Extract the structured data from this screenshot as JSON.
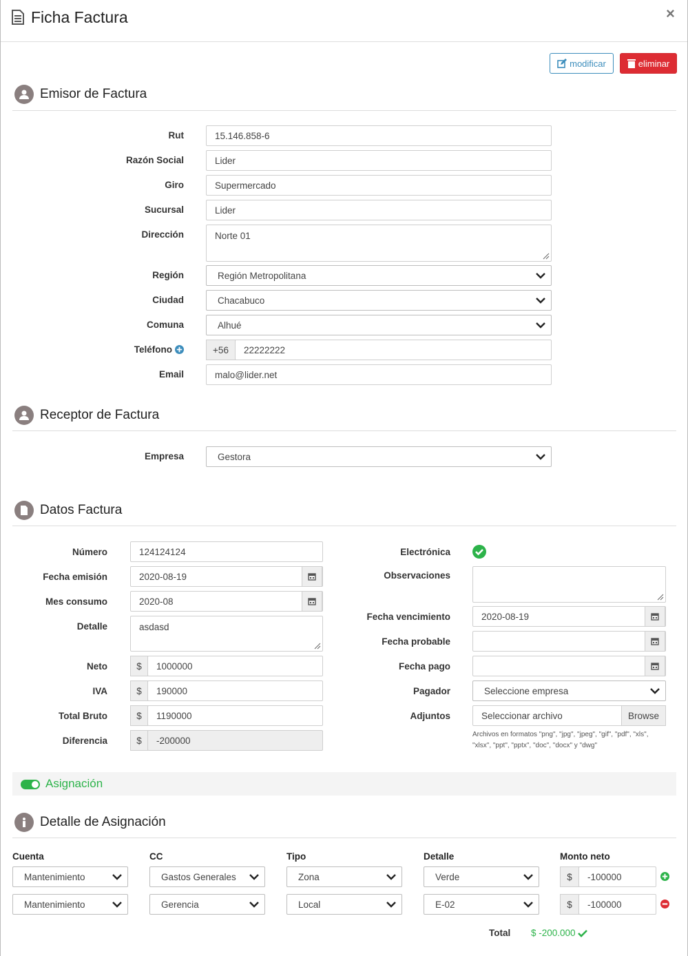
{
  "header": {
    "title": "Ficha Factura",
    "close": "×"
  },
  "actions": {
    "edit_label": "modificar",
    "delete_label": "eliminar"
  },
  "emisor": {
    "title": "Emisor de Factura",
    "rut": {
      "label": "Rut",
      "value": "15.146.858-6"
    },
    "razon_social": {
      "label": "Razón Social",
      "value": "Lider"
    },
    "giro": {
      "label": "Giro",
      "value": "Supermercado"
    },
    "sucursal": {
      "label": "Sucursal",
      "value": "Lider"
    },
    "direccion": {
      "label": "Dirección",
      "value": "Norte 01"
    },
    "region": {
      "label": "Región",
      "value": "Región Metropolitana"
    },
    "ciudad": {
      "label": "Ciudad",
      "value": "Chacabuco"
    },
    "comuna": {
      "label": "Comuna",
      "value": "Alhué"
    },
    "telefono": {
      "label": "Teléfono",
      "prefix": "+56",
      "value": "22222222"
    },
    "email": {
      "label": "Email",
      "value": "malo@lider.net"
    }
  },
  "receptor": {
    "title": "Receptor de Factura",
    "empresa": {
      "label": "Empresa",
      "value": "Gestora"
    }
  },
  "datos": {
    "title": "Datos Factura",
    "numero": {
      "label": "Número",
      "value": "124124124"
    },
    "fecha_emision": {
      "label": "Fecha emisión",
      "value": "2020-08-19"
    },
    "mes_consumo": {
      "label": "Mes consumo",
      "value": "2020-08"
    },
    "detalle": {
      "label": "Detalle",
      "value": "asdasd"
    },
    "neto": {
      "label": "Neto",
      "currency": "$",
      "value": "1000000"
    },
    "iva": {
      "label": "IVA",
      "currency": "$",
      "value": "190000"
    },
    "total_bruto": {
      "label": "Total Bruto",
      "currency": "$",
      "value": "1190000"
    },
    "diferencia": {
      "label": "Diferencia",
      "currency": "$",
      "value": "-200000"
    },
    "electronica": {
      "label": "Electrónica",
      "checked": true
    },
    "observaciones": {
      "label": "Observaciones",
      "value": ""
    },
    "fecha_vencimiento": {
      "label": "Fecha vencimiento",
      "value": "2020-08-19"
    },
    "fecha_probable": {
      "label": "Fecha probable",
      "value": ""
    },
    "fecha_pago": {
      "label": "Fecha pago",
      "value": ""
    },
    "pagador": {
      "label": "Pagador",
      "value": "Seleccione empresa"
    },
    "adjuntos": {
      "label": "Adjuntos",
      "placeholder": "Seleccionar archivo",
      "browse": "Browse",
      "hint": "Archivos en formatos \"png\", \"jpg\", \"jpeg\", \"gif\", \"pdf\", \"xls\", \"xlsx\", \"ppt\", \"pptx\", \"doc\", \"docx\" y \"dwg\""
    }
  },
  "asignacion": {
    "label": "Asignación",
    "enabled": true
  },
  "detalle_asignacion": {
    "title": "Detalle de Asignación",
    "columns": [
      "Cuenta",
      "CC",
      "Tipo",
      "Detalle",
      "Monto neto"
    ],
    "rows": [
      {
        "cuenta": "Mantenimiento",
        "cc": "Gastos Generales",
        "tipo": "Zona",
        "detalle": "Verde",
        "currency": "$",
        "monto": "-100000"
      },
      {
        "cuenta": "Mantenimiento",
        "cc": "Gerencia",
        "tipo": "Local",
        "detalle": "E-02",
        "currency": "$",
        "monto": "-100000"
      }
    ],
    "total_label": "Total",
    "total_value": "$ -200.000"
  },
  "colors": {
    "primary": "#3c8dbc",
    "danger": "#dd2c33",
    "success": "#2db34a",
    "section_icon": "#8a7f7f"
  }
}
